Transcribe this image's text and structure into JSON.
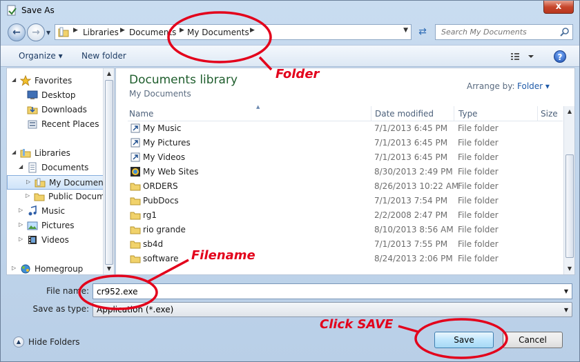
{
  "window": {
    "title": "Save As",
    "close_label": "x"
  },
  "navbar": {
    "breadcrumbs": [
      "Libraries",
      "Documents",
      "My Documents"
    ],
    "search_placeholder": "Search My Documents"
  },
  "cmdbar": {
    "organize": "Organize ▾",
    "new_folder": "New folder",
    "help": "?"
  },
  "navpane": {
    "items": [
      {
        "label": "Favorites",
        "icon": "star-icon"
      },
      {
        "label": "Desktop",
        "icon": "desktop-icon"
      },
      {
        "label": "Downloads",
        "icon": "downloads-icon"
      },
      {
        "label": "Recent Places",
        "icon": "recent-places-icon"
      },
      {
        "label": "Libraries",
        "icon": "libraries-icon"
      },
      {
        "label": "Documents",
        "icon": "documents-icon"
      },
      {
        "label": "My Documents",
        "icon": "folder-icon",
        "selected": true
      },
      {
        "label": "Public Documents",
        "icon": "folder-icon"
      },
      {
        "label": "Music",
        "icon": "music-icon"
      },
      {
        "label": "Pictures",
        "icon": "pictures-icon"
      },
      {
        "label": "Videos",
        "icon": "videos-icon"
      },
      {
        "label": "Homegroup",
        "icon": "homegroup-icon"
      }
    ]
  },
  "content": {
    "library_title": "Documents library",
    "library_subtitle": "My Documents",
    "arrange_label": "Arrange by:",
    "arrange_value": "Folder ▾",
    "columns": {
      "name": "Name",
      "date": "Date modified",
      "type": "Type",
      "size": "Size"
    },
    "rows": [
      {
        "name": "My Music",
        "date": "7/1/2013 6:45 PM",
        "type": "File folder",
        "icon": "shortcut-folder-icon"
      },
      {
        "name": "My Pictures",
        "date": "7/1/2013 6:45 PM",
        "type": "File folder",
        "icon": "shortcut-folder-icon"
      },
      {
        "name": "My Videos",
        "date": "7/1/2013 6:45 PM",
        "type": "File folder",
        "icon": "shortcut-folder-icon"
      },
      {
        "name": "My Web Sites",
        "date": "8/30/2013 2:49 PM",
        "type": "File folder",
        "icon": "web-sites-icon"
      },
      {
        "name": "ORDERS",
        "date": "8/26/2013 10:22 AM",
        "type": "File folder",
        "icon": "folder-icon"
      },
      {
        "name": "PubDocs",
        "date": "7/1/2013 7:54 PM",
        "type": "File folder",
        "icon": "folder-icon"
      },
      {
        "name": "rg1",
        "date": "2/2/2008 2:47 PM",
        "type": "File folder",
        "icon": "folder-icon"
      },
      {
        "name": "rio grande",
        "date": "8/10/2013 8:56 AM",
        "type": "File folder",
        "icon": "folder-icon"
      },
      {
        "name": "sb4d",
        "date": "7/1/2013 7:55 PM",
        "type": "File folder",
        "icon": "folder-icon"
      },
      {
        "name": "software",
        "date": "8/24/2013 2:06 PM",
        "type": "File folder",
        "icon": "folder-icon"
      }
    ]
  },
  "form": {
    "file_name_label": "File name:",
    "file_name_value": "cr952.exe",
    "save_type_label": "Save as type:",
    "save_type_value": "Application (*.exe)"
  },
  "footer": {
    "hide_folders": "Hide Folders",
    "save": "Save",
    "cancel": "Cancel"
  },
  "annotations": {
    "folder": "Folder",
    "filename": "Filename",
    "click_save": "Click SAVE",
    "color": "#e3001b"
  }
}
